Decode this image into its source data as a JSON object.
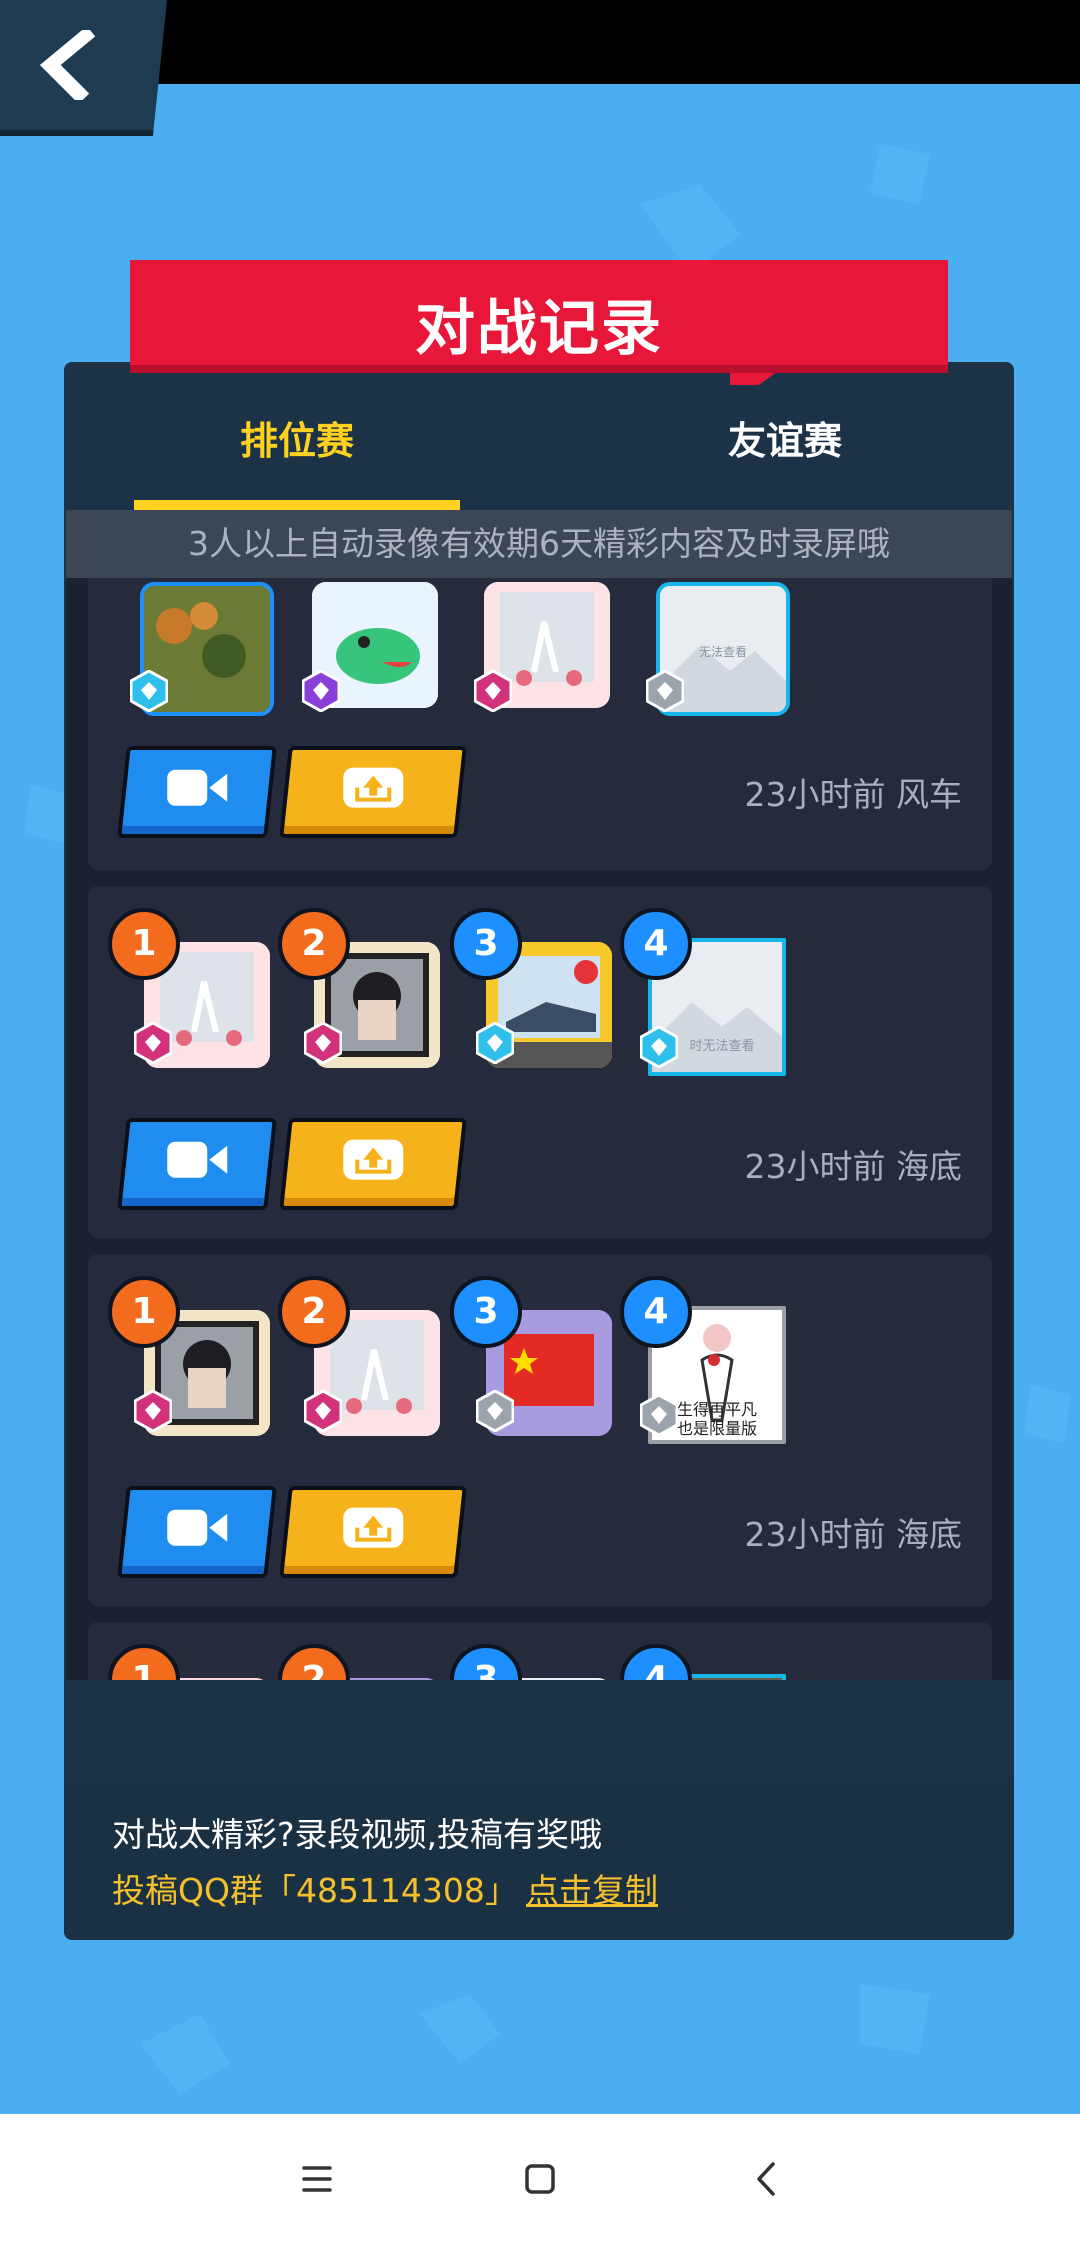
{
  "title": "对战记录",
  "tabs": [
    {
      "label": "排位赛",
      "active": true
    },
    {
      "label": "友谊赛",
      "active": false
    }
  ],
  "notice": "3人以上自动录像有效期6天精彩内容及时录屏哦",
  "records": [
    {
      "time": "23小时前 风车",
      "players": [
        {
          "rank": "",
          "tier": "diamond"
        },
        {
          "rank": "",
          "tier": "purple"
        },
        {
          "rank": "",
          "tier": "pink"
        },
        {
          "rank": "",
          "tier": "silver"
        }
      ]
    },
    {
      "time": "23小时前 海底",
      "players": [
        {
          "rank": "1",
          "tier": "pink"
        },
        {
          "rank": "2",
          "tier": "pink"
        },
        {
          "rank": "3",
          "tier": "diamond"
        },
        {
          "rank": "4",
          "tier": "diamond"
        }
      ]
    },
    {
      "time": "23小时前 海底",
      "players": [
        {
          "rank": "1",
          "tier": "pink"
        },
        {
          "rank": "2",
          "tier": "pink"
        },
        {
          "rank": "3",
          "tier": "silver"
        },
        {
          "rank": "4",
          "tier": "silver"
        }
      ]
    },
    {
      "time": "",
      "players": [
        {
          "rank": "1"
        },
        {
          "rank": "2"
        },
        {
          "rank": "3"
        },
        {
          "rank": "4"
        }
      ]
    }
  ],
  "avatar_text": {
    "unavailable": "时无法查看",
    "unavailable_small": "无法查看",
    "sticker_line1": "生得再平凡",
    "sticker_line2": "也是限量版"
  },
  "footer": {
    "line1": "对战太精彩?录段视频,投稿有奖哦",
    "line2": "投稿QQ群「485114308」",
    "copy_link": "点击复制"
  },
  "colors": {
    "accent": "#ffd21f",
    "banner": "#e8173a",
    "video_button": "#1f8cf0",
    "upload_button": "#f6b21a",
    "rank_orange": "#f36b1c",
    "rank_blue": "#1e8fff"
  },
  "icons": {
    "back": "chevron-left-icon",
    "video": "video-camera-icon",
    "upload": "upload-icon",
    "menu": "menu-icon",
    "home": "home-square-icon",
    "nav_back": "nav-back-icon"
  }
}
